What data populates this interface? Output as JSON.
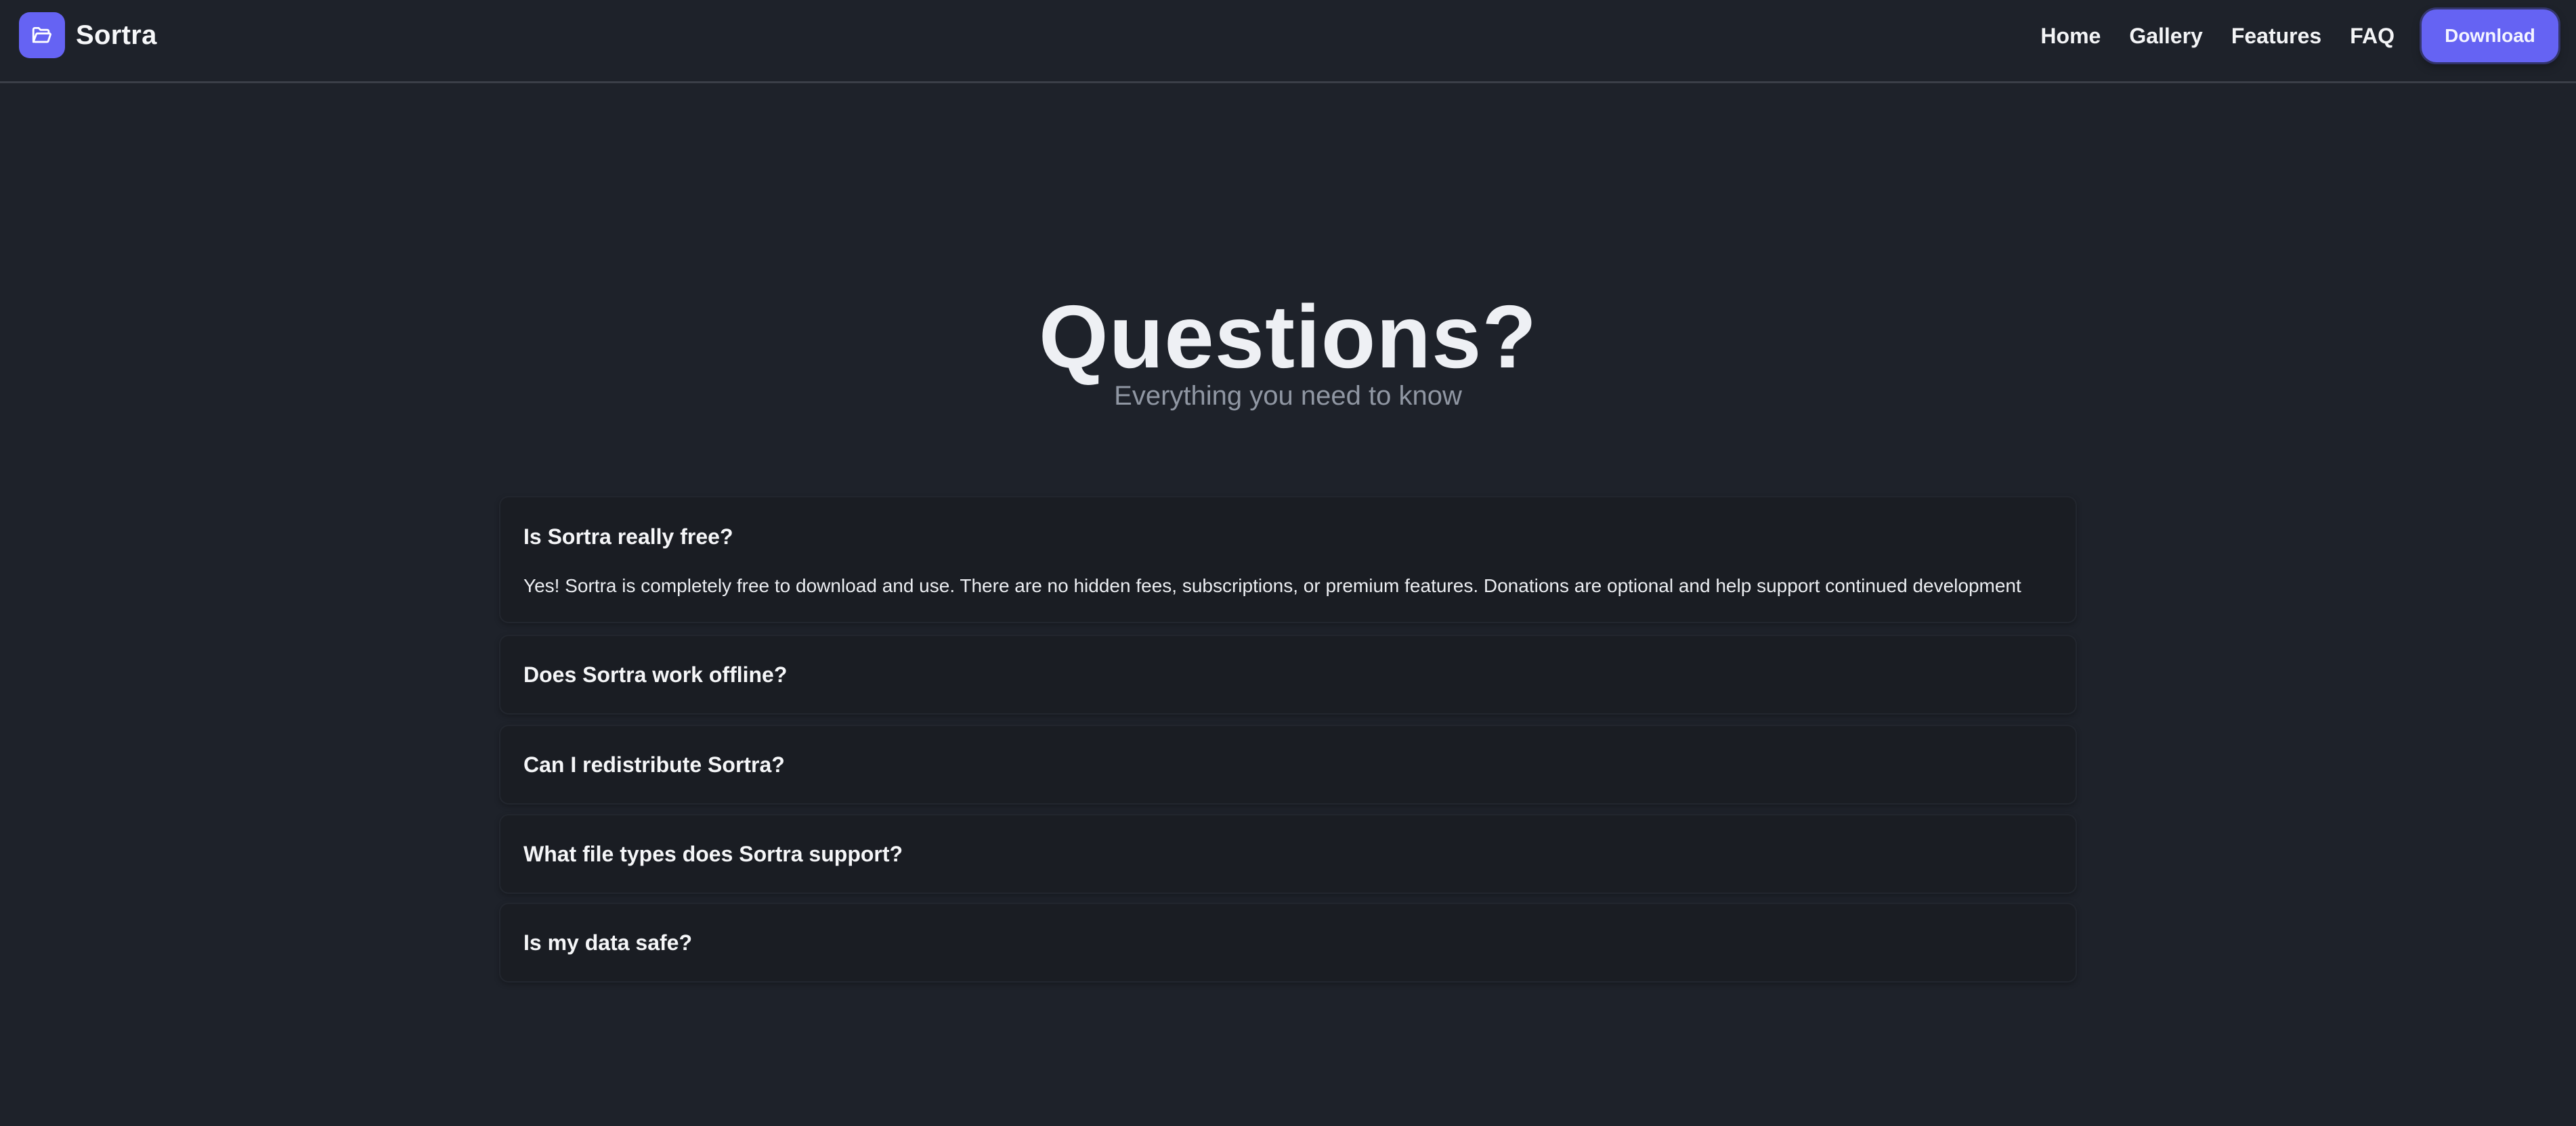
{
  "brand": {
    "name": "Sortra",
    "icon": "folder-icon",
    "accent_color": "#6563f3"
  },
  "nav": {
    "links": [
      "Home",
      "Gallery",
      "Features",
      "FAQ"
    ],
    "download_label": "Download"
  },
  "hero": {
    "title": "Questions?",
    "subtitle": "Everything you need to know"
  },
  "faq": [
    {
      "question": "Is Sortra really free?",
      "answer": "Yes! Sortra is completely free to download and use. There are no hidden fees, subscriptions, or premium features. Donations are optional and help support continued development",
      "expanded": true
    },
    {
      "question": "Does Sortra work offline?",
      "expanded": false
    },
    {
      "question": "Can I redistribute Sortra?",
      "expanded": false
    },
    {
      "question": "What file types does Sortra support?",
      "expanded": false
    },
    {
      "question": "Is my data safe?",
      "expanded": false
    }
  ]
}
